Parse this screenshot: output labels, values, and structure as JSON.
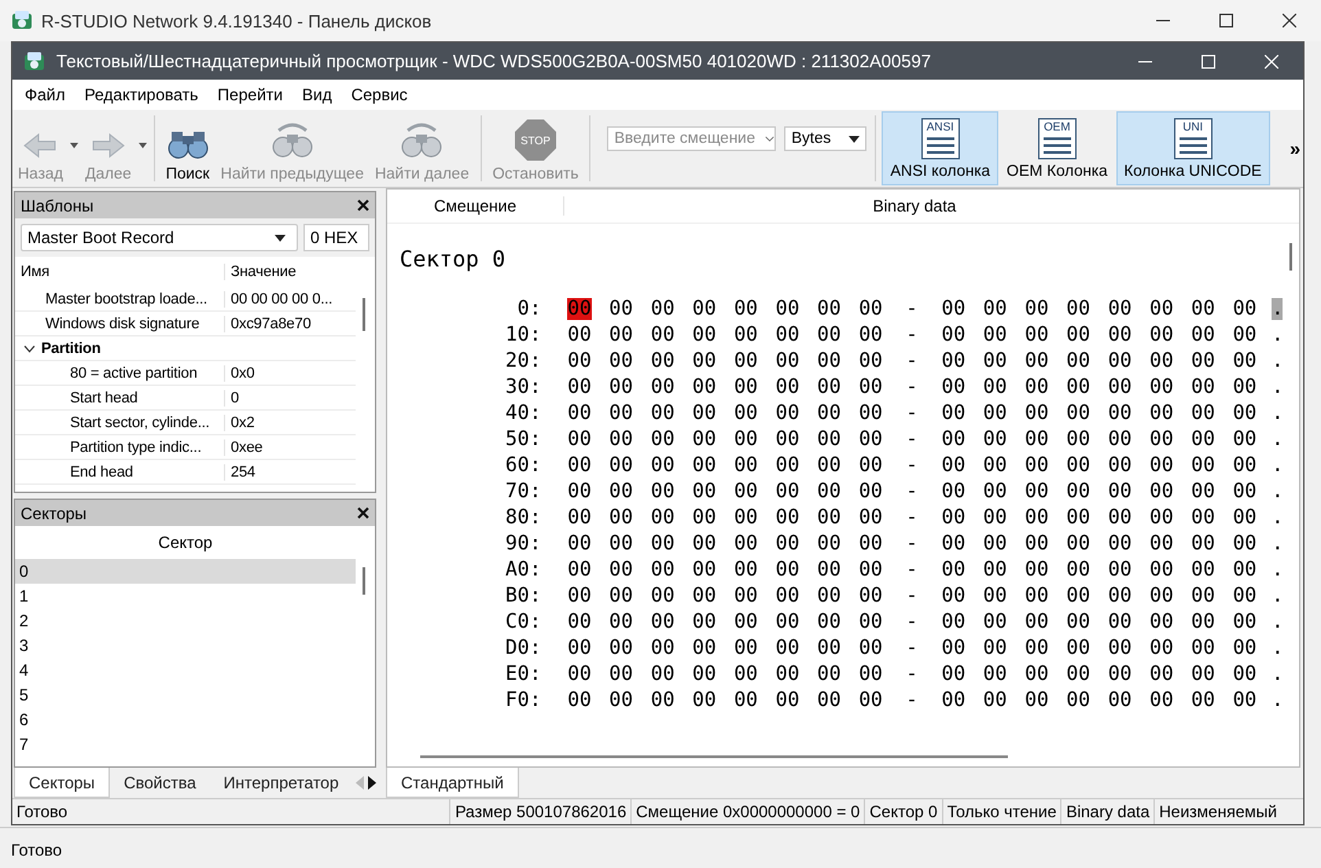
{
  "app_window": {
    "title": "R-STUDIO Network 9.4.191340 - Панель дисков",
    "status": "Готово"
  },
  "viewer_window": {
    "title": "Текстовый/Шестнадцатеричный просмотрщик - WDC WDS500G2B0A-00SM50 401020WD : 211302A00597"
  },
  "menu": [
    "Файл",
    "Редактировать",
    "Перейти",
    "Вид",
    "Сервис"
  ],
  "toolbar": {
    "buttons": [
      {
        "kind": "back",
        "label": "Назад",
        "disabled": true,
        "dropdown": true
      },
      {
        "kind": "forward",
        "label": "Далее",
        "disabled": true,
        "dropdown": true
      },
      {
        "kind": "search",
        "label": "Поиск",
        "disabled": false,
        "dropdown": false
      },
      {
        "kind": "prev",
        "label": "Найти предыдущее",
        "disabled": true,
        "dropdown": false
      },
      {
        "kind": "next",
        "label": "Найти далее",
        "disabled": true,
        "dropdown": false
      },
      {
        "kind": "stop",
        "label": "Остановить",
        "disabled": true,
        "dropdown": false,
        "icon_text": "STOP"
      }
    ],
    "offset_field": {
      "placeholder": "Введите смещение"
    },
    "unit_select": {
      "value": "Bytes"
    },
    "columns": [
      {
        "icon_text": "ANSI",
        "label": "ANSI колонка",
        "selected": true
      },
      {
        "icon_text": "OEM",
        "label": "OEM Колонка",
        "selected": false
      },
      {
        "icon_text": "UNI",
        "label": "Колонка UNICODE",
        "selected": true
      }
    ],
    "overflow": "»"
  },
  "templates_panel": {
    "title": "Шаблоны",
    "template": "Master Boot Record",
    "offset": "0 HEX",
    "columns": [
      "Имя",
      "Значение"
    ],
    "rows": [
      {
        "name": "Master bootstrap loade...",
        "value": "00 00 00 00 0..."
      },
      {
        "name": "Windows disk signature",
        "value": "0xc97a8e70"
      },
      {
        "name": "Partition",
        "expanded": true,
        "children": [
          {
            "name": "80 = active partition",
            "value": "0x0"
          },
          {
            "name": "Start head",
            "value": "0"
          },
          {
            "name": "Start sector, cylinde...",
            "value": "0x2"
          },
          {
            "name": "Partition type indic...",
            "value": "0xee"
          },
          {
            "name": "End head",
            "value": "254"
          }
        ]
      }
    ]
  },
  "sectors_panel": {
    "title": "Секторы",
    "column": "Сектор",
    "items": [
      {
        "label": "0",
        "selected": true
      },
      {
        "label": "1",
        "selected": false
      },
      {
        "label": "2",
        "selected": false
      },
      {
        "label": "3",
        "selected": false
      },
      {
        "label": "4",
        "selected": false
      },
      {
        "label": "5",
        "selected": false
      },
      {
        "label": "6",
        "selected": false
      },
      {
        "label": "7",
        "selected": false
      }
    ]
  },
  "left_tabs": [
    {
      "label": "Секторы",
      "selected": true
    },
    {
      "label": "Свойства",
      "selected": false
    },
    {
      "label": "Интерпретатор",
      "selected": false
    }
  ],
  "hex_view": {
    "columns": [
      "Смещение",
      "Binary data"
    ],
    "heading": "Сектор 0",
    "separator": "-",
    "rows": [
      {
        "offset": "0:",
        "ascii": ".",
        "ascii_selected": true,
        "bytes": [
          {
            "value": "00",
            "selected": true
          },
          {
            "value": "00",
            "selected": false
          },
          {
            "value": "00",
            "selected": false
          },
          {
            "value": "00",
            "selected": false
          },
          {
            "value": "00",
            "selected": false
          },
          {
            "value": "00",
            "selected": false
          },
          {
            "value": "00",
            "selected": false
          },
          {
            "value": "00",
            "selected": false
          },
          {
            "value": "00",
            "selected": false
          },
          {
            "value": "00",
            "selected": false
          },
          {
            "value": "00",
            "selected": false
          },
          {
            "value": "00",
            "selected": false
          },
          {
            "value": "00",
            "selected": false
          },
          {
            "value": "00",
            "selected": false
          },
          {
            "value": "00",
            "selected": false
          },
          {
            "value": "00",
            "selected": false
          }
        ]
      },
      {
        "offset": "10:",
        "ascii": ".",
        "ascii_selected": false,
        "bytes": [
          {
            "value": "00",
            "selected": false
          },
          {
            "value": "00",
            "selected": false
          },
          {
            "value": "00",
            "selected": false
          },
          {
            "value": "00",
            "selected": false
          },
          {
            "value": "00",
            "selected": false
          },
          {
            "value": "00",
            "selected": false
          },
          {
            "value": "00",
            "selected": false
          },
          {
            "value": "00",
            "selected": false
          },
          {
            "value": "00",
            "selected": false
          },
          {
            "value": "00",
            "selected": false
          },
          {
            "value": "00",
            "selected": false
          },
          {
            "value": "00",
            "selected": false
          },
          {
            "value": "00",
            "selected": false
          },
          {
            "value": "00",
            "selected": false
          },
          {
            "value": "00",
            "selected": false
          },
          {
            "value": "00",
            "selected": false
          }
        ]
      },
      {
        "offset": "20:",
        "ascii": ".",
        "ascii_selected": false,
        "bytes": [
          {
            "value": "00",
            "selected": false
          },
          {
            "value": "00",
            "selected": false
          },
          {
            "value": "00",
            "selected": false
          },
          {
            "value": "00",
            "selected": false
          },
          {
            "value": "00",
            "selected": false
          },
          {
            "value": "00",
            "selected": false
          },
          {
            "value": "00",
            "selected": false
          },
          {
            "value": "00",
            "selected": false
          },
          {
            "value": "00",
            "selected": false
          },
          {
            "value": "00",
            "selected": false
          },
          {
            "value": "00",
            "selected": false
          },
          {
            "value": "00",
            "selected": false
          },
          {
            "value": "00",
            "selected": false
          },
          {
            "value": "00",
            "selected": false
          },
          {
            "value": "00",
            "selected": false
          },
          {
            "value": "00",
            "selected": false
          }
        ]
      },
      {
        "offset": "30:",
        "ascii": ".",
        "ascii_selected": false,
        "bytes": [
          {
            "value": "00",
            "selected": false
          },
          {
            "value": "00",
            "selected": false
          },
          {
            "value": "00",
            "selected": false
          },
          {
            "value": "00",
            "selected": false
          },
          {
            "value": "00",
            "selected": false
          },
          {
            "value": "00",
            "selected": false
          },
          {
            "value": "00",
            "selected": false
          },
          {
            "value": "00",
            "selected": false
          },
          {
            "value": "00",
            "selected": false
          },
          {
            "value": "00",
            "selected": false
          },
          {
            "value": "00",
            "selected": false
          },
          {
            "value": "00",
            "selected": false
          },
          {
            "value": "00",
            "selected": false
          },
          {
            "value": "00",
            "selected": false
          },
          {
            "value": "00",
            "selected": false
          },
          {
            "value": "00",
            "selected": false
          }
        ]
      },
      {
        "offset": "40:",
        "ascii": ".",
        "ascii_selected": false,
        "bytes": [
          {
            "value": "00",
            "selected": false
          },
          {
            "value": "00",
            "selected": false
          },
          {
            "value": "00",
            "selected": false
          },
          {
            "value": "00",
            "selected": false
          },
          {
            "value": "00",
            "selected": false
          },
          {
            "value": "00",
            "selected": false
          },
          {
            "value": "00",
            "selected": false
          },
          {
            "value": "00",
            "selected": false
          },
          {
            "value": "00",
            "selected": false
          },
          {
            "value": "00",
            "selected": false
          },
          {
            "value": "00",
            "selected": false
          },
          {
            "value": "00",
            "selected": false
          },
          {
            "value": "00",
            "selected": false
          },
          {
            "value": "00",
            "selected": false
          },
          {
            "value": "00",
            "selected": false
          },
          {
            "value": "00",
            "selected": false
          }
        ]
      },
      {
        "offset": "50:",
        "ascii": ".",
        "ascii_selected": false,
        "bytes": [
          {
            "value": "00",
            "selected": false
          },
          {
            "value": "00",
            "selected": false
          },
          {
            "value": "00",
            "selected": false
          },
          {
            "value": "00",
            "selected": false
          },
          {
            "value": "00",
            "selected": false
          },
          {
            "value": "00",
            "selected": false
          },
          {
            "value": "00",
            "selected": false
          },
          {
            "value": "00",
            "selected": false
          },
          {
            "value": "00",
            "selected": false
          },
          {
            "value": "00",
            "selected": false
          },
          {
            "value": "00",
            "selected": false
          },
          {
            "value": "00",
            "selected": false
          },
          {
            "value": "00",
            "selected": false
          },
          {
            "value": "00",
            "selected": false
          },
          {
            "value": "00",
            "selected": false
          },
          {
            "value": "00",
            "selected": false
          }
        ]
      },
      {
        "offset": "60:",
        "ascii": ".",
        "ascii_selected": false,
        "bytes": [
          {
            "value": "00",
            "selected": false
          },
          {
            "value": "00",
            "selected": false
          },
          {
            "value": "00",
            "selected": false
          },
          {
            "value": "00",
            "selected": false
          },
          {
            "value": "00",
            "selected": false
          },
          {
            "value": "00",
            "selected": false
          },
          {
            "value": "00",
            "selected": false
          },
          {
            "value": "00",
            "selected": false
          },
          {
            "value": "00",
            "selected": false
          },
          {
            "value": "00",
            "selected": false
          },
          {
            "value": "00",
            "selected": false
          },
          {
            "value": "00",
            "selected": false
          },
          {
            "value": "00",
            "selected": false
          },
          {
            "value": "00",
            "selected": false
          },
          {
            "value": "00",
            "selected": false
          },
          {
            "value": "00",
            "selected": false
          }
        ]
      },
      {
        "offset": "70:",
        "ascii": ".",
        "ascii_selected": false,
        "bytes": [
          {
            "value": "00",
            "selected": false
          },
          {
            "value": "00",
            "selected": false
          },
          {
            "value": "00",
            "selected": false
          },
          {
            "value": "00",
            "selected": false
          },
          {
            "value": "00",
            "selected": false
          },
          {
            "value": "00",
            "selected": false
          },
          {
            "value": "00",
            "selected": false
          },
          {
            "value": "00",
            "selected": false
          },
          {
            "value": "00",
            "selected": false
          },
          {
            "value": "00",
            "selected": false
          },
          {
            "value": "00",
            "selected": false
          },
          {
            "value": "00",
            "selected": false
          },
          {
            "value": "00",
            "selected": false
          },
          {
            "value": "00",
            "selected": false
          },
          {
            "value": "00",
            "selected": false
          },
          {
            "value": "00",
            "selected": false
          }
        ]
      },
      {
        "offset": "80:",
        "ascii": ".",
        "ascii_selected": false,
        "bytes": [
          {
            "value": "00",
            "selected": false
          },
          {
            "value": "00",
            "selected": false
          },
          {
            "value": "00",
            "selected": false
          },
          {
            "value": "00",
            "selected": false
          },
          {
            "value": "00",
            "selected": false
          },
          {
            "value": "00",
            "selected": false
          },
          {
            "value": "00",
            "selected": false
          },
          {
            "value": "00",
            "selected": false
          },
          {
            "value": "00",
            "selected": false
          },
          {
            "value": "00",
            "selected": false
          },
          {
            "value": "00",
            "selected": false
          },
          {
            "value": "00",
            "selected": false
          },
          {
            "value": "00",
            "selected": false
          },
          {
            "value": "00",
            "selected": false
          },
          {
            "value": "00",
            "selected": false
          },
          {
            "value": "00",
            "selected": false
          }
        ]
      },
      {
        "offset": "90:",
        "ascii": ".",
        "ascii_selected": false,
        "bytes": [
          {
            "value": "00",
            "selected": false
          },
          {
            "value": "00",
            "selected": false
          },
          {
            "value": "00",
            "selected": false
          },
          {
            "value": "00",
            "selected": false
          },
          {
            "value": "00",
            "selected": false
          },
          {
            "value": "00",
            "selected": false
          },
          {
            "value": "00",
            "selected": false
          },
          {
            "value": "00",
            "selected": false
          },
          {
            "value": "00",
            "selected": false
          },
          {
            "value": "00",
            "selected": false
          },
          {
            "value": "00",
            "selected": false
          },
          {
            "value": "00",
            "selected": false
          },
          {
            "value": "00",
            "selected": false
          },
          {
            "value": "00",
            "selected": false
          },
          {
            "value": "00",
            "selected": false
          },
          {
            "value": "00",
            "selected": false
          }
        ]
      },
      {
        "offset": "A0:",
        "ascii": ".",
        "ascii_selected": false,
        "bytes": [
          {
            "value": "00",
            "selected": false
          },
          {
            "value": "00",
            "selected": false
          },
          {
            "value": "00",
            "selected": false
          },
          {
            "value": "00",
            "selected": false
          },
          {
            "value": "00",
            "selected": false
          },
          {
            "value": "00",
            "selected": false
          },
          {
            "value": "00",
            "selected": false
          },
          {
            "value": "00",
            "selected": false
          },
          {
            "value": "00",
            "selected": false
          },
          {
            "value": "00",
            "selected": false
          },
          {
            "value": "00",
            "selected": false
          },
          {
            "value": "00",
            "selected": false
          },
          {
            "value": "00",
            "selected": false
          },
          {
            "value": "00",
            "selected": false
          },
          {
            "value": "00",
            "selected": false
          },
          {
            "value": "00",
            "selected": false
          }
        ]
      },
      {
        "offset": "B0:",
        "ascii": ".",
        "ascii_selected": false,
        "bytes": [
          {
            "value": "00",
            "selected": false
          },
          {
            "value": "00",
            "selected": false
          },
          {
            "value": "00",
            "selected": false
          },
          {
            "value": "00",
            "selected": false
          },
          {
            "value": "00",
            "selected": false
          },
          {
            "value": "00",
            "selected": false
          },
          {
            "value": "00",
            "selected": false
          },
          {
            "value": "00",
            "selected": false
          },
          {
            "value": "00",
            "selected": false
          },
          {
            "value": "00",
            "selected": false
          },
          {
            "value": "00",
            "selected": false
          },
          {
            "value": "00",
            "selected": false
          },
          {
            "value": "00",
            "selected": false
          },
          {
            "value": "00",
            "selected": false
          },
          {
            "value": "00",
            "selected": false
          },
          {
            "value": "00",
            "selected": false
          }
        ]
      },
      {
        "offset": "C0:",
        "ascii": ".",
        "ascii_selected": false,
        "bytes": [
          {
            "value": "00",
            "selected": false
          },
          {
            "value": "00",
            "selected": false
          },
          {
            "value": "00",
            "selected": false
          },
          {
            "value": "00",
            "selected": false
          },
          {
            "value": "00",
            "selected": false
          },
          {
            "value": "00",
            "selected": false
          },
          {
            "value": "00",
            "selected": false
          },
          {
            "value": "00",
            "selected": false
          },
          {
            "value": "00",
            "selected": false
          },
          {
            "value": "00",
            "selected": false
          },
          {
            "value": "00",
            "selected": false
          },
          {
            "value": "00",
            "selected": false
          },
          {
            "value": "00",
            "selected": false
          },
          {
            "value": "00",
            "selected": false
          },
          {
            "value": "00",
            "selected": false
          },
          {
            "value": "00",
            "selected": false
          }
        ]
      },
      {
        "offset": "D0:",
        "ascii": ".",
        "ascii_selected": false,
        "bytes": [
          {
            "value": "00",
            "selected": false
          },
          {
            "value": "00",
            "selected": false
          },
          {
            "value": "00",
            "selected": false
          },
          {
            "value": "00",
            "selected": false
          },
          {
            "value": "00",
            "selected": false
          },
          {
            "value": "00",
            "selected": false
          },
          {
            "value": "00",
            "selected": false
          },
          {
            "value": "00",
            "selected": false
          },
          {
            "value": "00",
            "selected": false
          },
          {
            "value": "00",
            "selected": false
          },
          {
            "value": "00",
            "selected": false
          },
          {
            "value": "00",
            "selected": false
          },
          {
            "value": "00",
            "selected": false
          },
          {
            "value": "00",
            "selected": false
          },
          {
            "value": "00",
            "selected": false
          },
          {
            "value": "00",
            "selected": false
          }
        ]
      },
      {
        "offset": "E0:",
        "ascii": ".",
        "ascii_selected": false,
        "bytes": [
          {
            "value": "00",
            "selected": false
          },
          {
            "value": "00",
            "selected": false
          },
          {
            "value": "00",
            "selected": false
          },
          {
            "value": "00",
            "selected": false
          },
          {
            "value": "00",
            "selected": false
          },
          {
            "value": "00",
            "selected": false
          },
          {
            "value": "00",
            "selected": false
          },
          {
            "value": "00",
            "selected": false
          },
          {
            "value": "00",
            "selected": false
          },
          {
            "value": "00",
            "selected": false
          },
          {
            "value": "00",
            "selected": false
          },
          {
            "value": "00",
            "selected": false
          },
          {
            "value": "00",
            "selected": false
          },
          {
            "value": "00",
            "selected": false
          },
          {
            "value": "00",
            "selected": false
          },
          {
            "value": "00",
            "selected": false
          }
        ]
      },
      {
        "offset": "F0:",
        "ascii": ".",
        "ascii_selected": false,
        "bytes": [
          {
            "value": "00",
            "selected": false
          },
          {
            "value": "00",
            "selected": false
          },
          {
            "value": "00",
            "selected": false
          },
          {
            "value": "00",
            "selected": false
          },
          {
            "value": "00",
            "selected": false
          },
          {
            "value": "00",
            "selected": false
          },
          {
            "value": "00",
            "selected": false
          },
          {
            "value": "00",
            "selected": false
          },
          {
            "value": "00",
            "selected": false
          },
          {
            "value": "00",
            "selected": false
          },
          {
            "value": "00",
            "selected": false
          },
          {
            "value": "00",
            "selected": false
          },
          {
            "value": "00",
            "selected": false
          },
          {
            "value": "00",
            "selected": false
          },
          {
            "value": "00",
            "selected": false
          },
          {
            "value": "00",
            "selected": false
          }
        ]
      }
    ]
  },
  "right_tabs": [
    {
      "label": "Стандартный",
      "selected": true
    }
  ],
  "status_bar": {
    "text": "Готово",
    "fields": [
      "Размер 500107862016",
      "Смещение 0x0000000000 = 0",
      "Сектор 0",
      "Только чтение",
      "Binary data",
      "Неизменяемый"
    ]
  }
}
